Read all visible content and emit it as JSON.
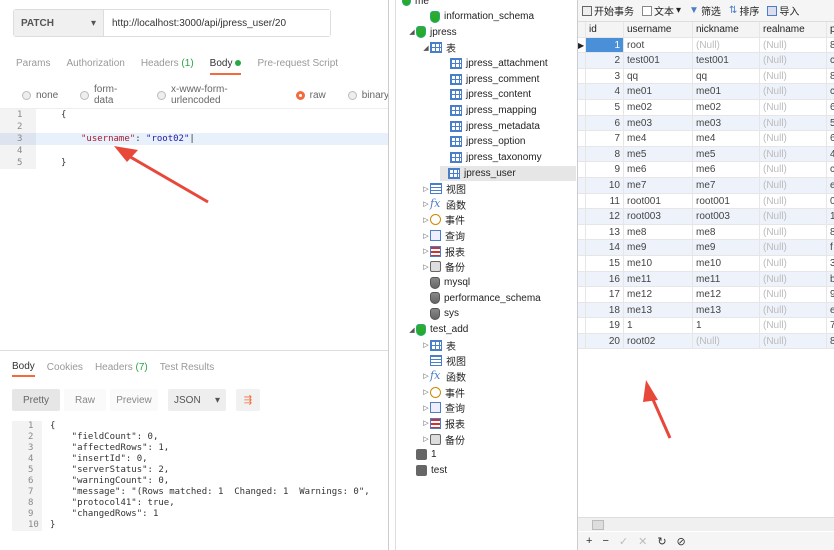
{
  "request": {
    "method": "PATCH",
    "url": "http://localhost:3000/api/jpress_user/20"
  },
  "req_tabs": [
    {
      "label": "Params"
    },
    {
      "label": "Authorization"
    },
    {
      "label": "Headers",
      "count": "(1)"
    },
    {
      "label": "Body",
      "active": true
    },
    {
      "label": "Pre-request Script"
    }
  ],
  "body_types": [
    "none",
    "form-data",
    "x-www-form-urlencoded",
    "raw",
    "binary"
  ],
  "editor_lines": [
    {
      "n": "1",
      "code": "{"
    },
    {
      "n": "2",
      "code": ""
    },
    {
      "n": "3",
      "key": "\"username\"",
      "sep": ": ",
      "val": "\"root02\""
    },
    {
      "n": "4",
      "code": ""
    },
    {
      "n": "5",
      "code": "}"
    }
  ],
  "resp_tabs": [
    {
      "label": "Body",
      "active": true
    },
    {
      "label": "Cookies"
    },
    {
      "label": "Headers",
      "count": "(7)"
    },
    {
      "label": "Test Results"
    }
  ],
  "resp_buttons": {
    "pretty": "Pretty",
    "raw": "Raw",
    "preview": "Preview",
    "format": "JSON"
  },
  "resp_lines": [
    {
      "n": "1",
      "code": "{"
    },
    {
      "n": "2",
      "code": "    \"fieldCount\": 0,"
    },
    {
      "n": "3",
      "code": "    \"affectedRows\": 1,"
    },
    {
      "n": "4",
      "code": "    \"insertId\": 0,"
    },
    {
      "n": "5",
      "code": "    \"serverStatus\": 2,"
    },
    {
      "n": "6",
      "code": "    \"warningCount\": 0,"
    },
    {
      "n": "7",
      "code": "    \"message\": \"(Rows matched: 1  Changed: 1  Warnings: 0\","
    },
    {
      "n": "8",
      "code": "    \"protocol41\": true,"
    },
    {
      "n": "9",
      "code": "    \"changedRows\": 1"
    },
    {
      "n": "10",
      "code": "}"
    }
  ],
  "tree": {
    "top_partial": "me",
    "items": [
      {
        "label": "information_schema",
        "icon": "db",
        "indent": 1
      },
      {
        "label": "jpress",
        "icon": "db",
        "indent": 0,
        "tri": "◢"
      },
      {
        "label": "表",
        "icon": "tbl",
        "indent": 1,
        "tri": "◢"
      },
      {
        "label": "jpress_attachment",
        "icon": "tbl",
        "indent": 2
      },
      {
        "label": "jpress_comment",
        "icon": "tbl",
        "indent": 2
      },
      {
        "label": "jpress_content",
        "icon": "tbl",
        "indent": 2
      },
      {
        "label": "jpress_mapping",
        "icon": "tbl",
        "indent": 2
      },
      {
        "label": "jpress_metadata",
        "icon": "tbl",
        "indent": 2
      },
      {
        "label": "jpress_option",
        "icon": "tbl",
        "indent": 2
      },
      {
        "label": "jpress_taxonomy",
        "icon": "tbl",
        "indent": 2
      },
      {
        "label": "jpress_user",
        "icon": "tbl",
        "indent": 2,
        "selected": true
      },
      {
        "label": "视图",
        "icon": "view",
        "indent": 1,
        "tri": "▷"
      },
      {
        "label": "函数",
        "icon": "fx",
        "indent": 1,
        "tri": "▷"
      },
      {
        "label": "事件",
        "icon": "evt",
        "indent": 1,
        "tri": "▷"
      },
      {
        "label": "查询",
        "icon": "qry",
        "indent": 1,
        "tri": "▷"
      },
      {
        "label": "报表",
        "icon": "rpt",
        "indent": 1,
        "tri": "▷"
      },
      {
        "label": "备份",
        "icon": "bak",
        "indent": 1,
        "tri": "▷"
      },
      {
        "label": "mysql",
        "icon": "dbg",
        "indent": 1
      },
      {
        "label": "performance_schema",
        "icon": "dbg",
        "indent": 1
      },
      {
        "label": "sys",
        "icon": "dbg",
        "indent": 1
      },
      {
        "label": "test_add",
        "icon": "db",
        "indent": 0,
        "tri": "◢"
      },
      {
        "label": "表",
        "icon": "tbl",
        "indent": 1,
        "tri": "▷"
      },
      {
        "label": "视图",
        "icon": "view",
        "indent": 1
      },
      {
        "label": "函数",
        "icon": "fx",
        "indent": 1,
        "tri": "▷"
      },
      {
        "label": "事件",
        "icon": "evt",
        "indent": 1,
        "tri": "▷"
      },
      {
        "label": "查询",
        "icon": "qry",
        "indent": 1,
        "tri": "▷"
      },
      {
        "label": "报表",
        "icon": "rpt",
        "indent": 1,
        "tri": "▷"
      },
      {
        "label": "备份",
        "icon": "bak",
        "indent": 1,
        "tri": "▷"
      },
      {
        "label": "1",
        "icon": "svr",
        "indent": -1
      },
      {
        "label": "test",
        "icon": "svr",
        "indent": -1
      }
    ]
  },
  "toolbar": {
    "begin": "开始事务",
    "text": "文本",
    "filter": "筛选",
    "sort": "排序",
    "import": "导入"
  },
  "columns": [
    "id",
    "username",
    "nickname",
    "realname",
    "p"
  ],
  "rows": [
    {
      "id": "1",
      "username": "root",
      "nickname": "(Null)",
      "realname": "(Null)",
      "p": "8"
    },
    {
      "id": "2",
      "username": "test001",
      "nickname": "test001",
      "realname": "(Null)",
      "p": "c"
    },
    {
      "id": "3",
      "username": "qq",
      "nickname": "qq",
      "realname": "(Null)",
      "p": "8"
    },
    {
      "id": "4",
      "username": "me01",
      "nickname": "me01",
      "realname": "(Null)",
      "p": "c"
    },
    {
      "id": "5",
      "username": "me02",
      "nickname": "me02",
      "realname": "(Null)",
      "p": "6"
    },
    {
      "id": "6",
      "username": "me03",
      "nickname": "me03",
      "realname": "(Null)",
      "p": "5"
    },
    {
      "id": "7",
      "username": "me4",
      "nickname": "me4",
      "realname": "(Null)",
      "p": "6"
    },
    {
      "id": "8",
      "username": "me5",
      "nickname": "me5",
      "realname": "(Null)",
      "p": "4"
    },
    {
      "id": "9",
      "username": "me6",
      "nickname": "me6",
      "realname": "(Null)",
      "p": "c"
    },
    {
      "id": "10",
      "username": "me7",
      "nickname": "me7",
      "realname": "(Null)",
      "p": "e"
    },
    {
      "id": "11",
      "username": "root001",
      "nickname": "root001",
      "realname": "(Null)",
      "p": "0"
    },
    {
      "id": "12",
      "username": "root003",
      "nickname": "root003",
      "realname": "(Null)",
      "p": "1"
    },
    {
      "id": "13",
      "username": "me8",
      "nickname": "me8",
      "realname": "(Null)",
      "p": "8"
    },
    {
      "id": "14",
      "username": "me9",
      "nickname": "me9",
      "realname": "(Null)",
      "p": "f"
    },
    {
      "id": "15",
      "username": "me10",
      "nickname": "me10",
      "realname": "(Null)",
      "p": "3"
    },
    {
      "id": "16",
      "username": "me11",
      "nickname": "me11",
      "realname": "(Null)",
      "p": "b"
    },
    {
      "id": "17",
      "username": "me12",
      "nickname": "me12",
      "realname": "(Null)",
      "p": "9"
    },
    {
      "id": "18",
      "username": "me13",
      "nickname": "me13",
      "realname": "(Null)",
      "p": "e"
    },
    {
      "id": "19",
      "username": "1",
      "nickname": "1",
      "realname": "(Null)",
      "p": "7"
    },
    {
      "id": "20",
      "username": "root02",
      "nickname": "(Null)",
      "realname": "(Null)",
      "p": "8"
    }
  ],
  "bottom_bar": [
    "+",
    "−",
    "✓",
    "✕",
    "↻",
    "⊘"
  ],
  "colors": {
    "accent": "#f26b3a",
    "annotation": "#e8483a",
    "green": "#28a745",
    "selection": "#4a90d9"
  }
}
